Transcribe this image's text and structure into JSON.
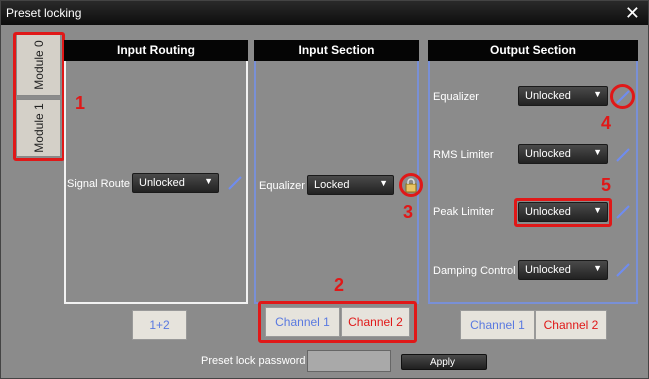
{
  "window": {
    "title": "Preset locking",
    "close_icon": "close-icon"
  },
  "modules": [
    "Module 0",
    "Module 1"
  ],
  "annotations": [
    "1",
    "2",
    "3",
    "4",
    "5"
  ],
  "colors": {
    "highlight": "#e01818",
    "channel_blue": "#5a79e0",
    "channel_red": "#e01818"
  },
  "input_routing": {
    "header": "Input Routing",
    "signal_route_label": "Signal Route",
    "signal_route_value": "Unlocked",
    "button": "1+2"
  },
  "input_section": {
    "header": "Input Section",
    "equalizer_label": "Equalizer",
    "equalizer_value": "Locked",
    "channel1": "Channel 1",
    "channel2": "Channel 2"
  },
  "output_section": {
    "header": "Output Section",
    "rows": [
      {
        "label": "Equalizer",
        "value": "Unlocked"
      },
      {
        "label": "RMS Limiter",
        "value": "Unlocked"
      },
      {
        "label": "Peak Limiter",
        "value": "Unlocked"
      },
      {
        "label": "Damping Control",
        "value": "Unlocked"
      }
    ],
    "channel1": "Channel 1",
    "channel2": "Channel 2"
  },
  "password": {
    "label": "Preset lock password",
    "value": "",
    "apply": "Apply"
  }
}
